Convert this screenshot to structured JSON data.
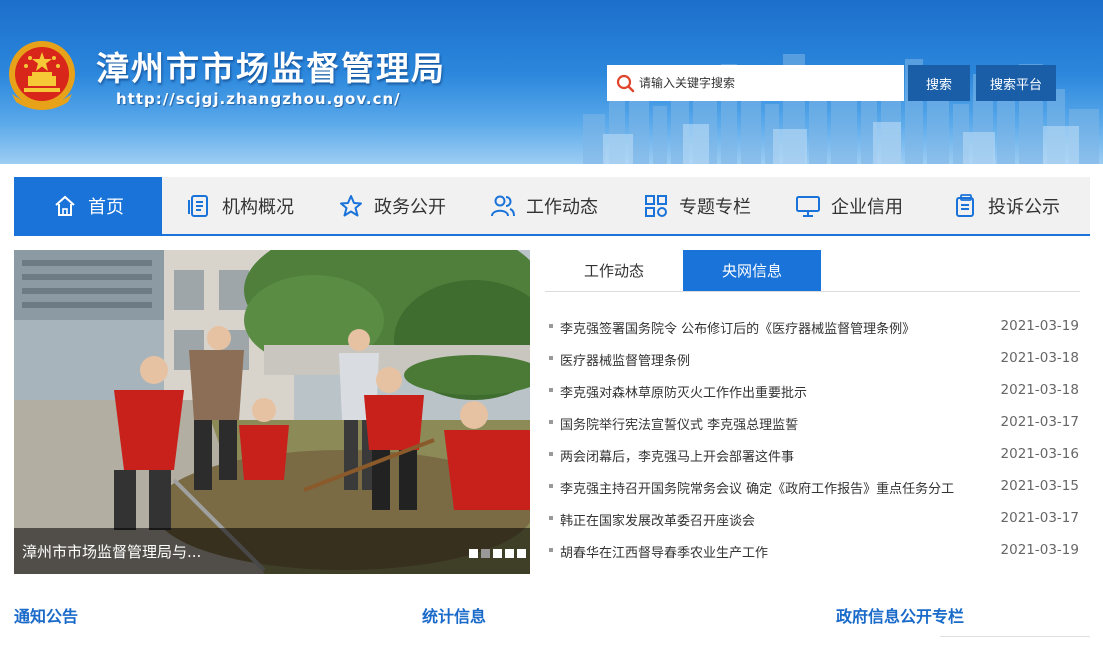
{
  "header": {
    "title": "漳州市市场监督管理局",
    "url": "http://scjgj.zhangzhou.gov.cn/",
    "search_placeholder": "请输入关键字搜索",
    "search_button": "搜索",
    "platform_button": "搜索平台",
    "emblem_icon": "national-emblem-icon"
  },
  "nav": {
    "items": [
      {
        "label": "首页",
        "icon": "home-icon"
      },
      {
        "label": "机构概况",
        "icon": "document-list-icon"
      },
      {
        "label": "政务公开",
        "icon": "star-icon"
      },
      {
        "label": "工作动态",
        "icon": "users-icon"
      },
      {
        "label": "专题专栏",
        "icon": "grid-icon"
      },
      {
        "label": "企业信用",
        "icon": "monitor-icon"
      },
      {
        "label": "投诉公示",
        "icon": "clipboard-icon"
      }
    ],
    "active_index": 0
  },
  "banner": {
    "caption": "漳州市市场监督管理局与...",
    "slide_count": 5,
    "active_slide": 2
  },
  "news": {
    "tabs": [
      "工作动态",
      "央网信息"
    ],
    "active_tab": 1,
    "items": [
      {
        "title": "李克强签署国务院令 公布修订后的《医疗器械监督管理条例》",
        "date": "2021-03-19"
      },
      {
        "title": "医疗器械监督管理条例",
        "date": "2021-03-18"
      },
      {
        "title": "李克强对森林草原防灭火工作作出重要批示",
        "date": "2021-03-18"
      },
      {
        "title": "国务院举行宪法宣誓仪式 李克强总理监誓",
        "date": "2021-03-17"
      },
      {
        "title": "两会闭幕后，李克强马上开会部署这件事",
        "date": "2021-03-16"
      },
      {
        "title": "李克强主持召开国务院常务会议 确定《政府工作报告》重点任务分工",
        "date": "2021-03-15"
      },
      {
        "title": "韩正在国家发展改革委召开座谈会",
        "date": "2021-03-17"
      },
      {
        "title": "胡春华在江西督导春季农业生产工作",
        "date": "2021-03-19"
      }
    ]
  },
  "sections": {
    "notice": "通知公告",
    "stats": "统计信息",
    "gov_info": "政府信息公开专栏"
  },
  "colors": {
    "primary": "#1a73d9",
    "button": "#1a5ea8",
    "heading": "#1a6ac9"
  }
}
